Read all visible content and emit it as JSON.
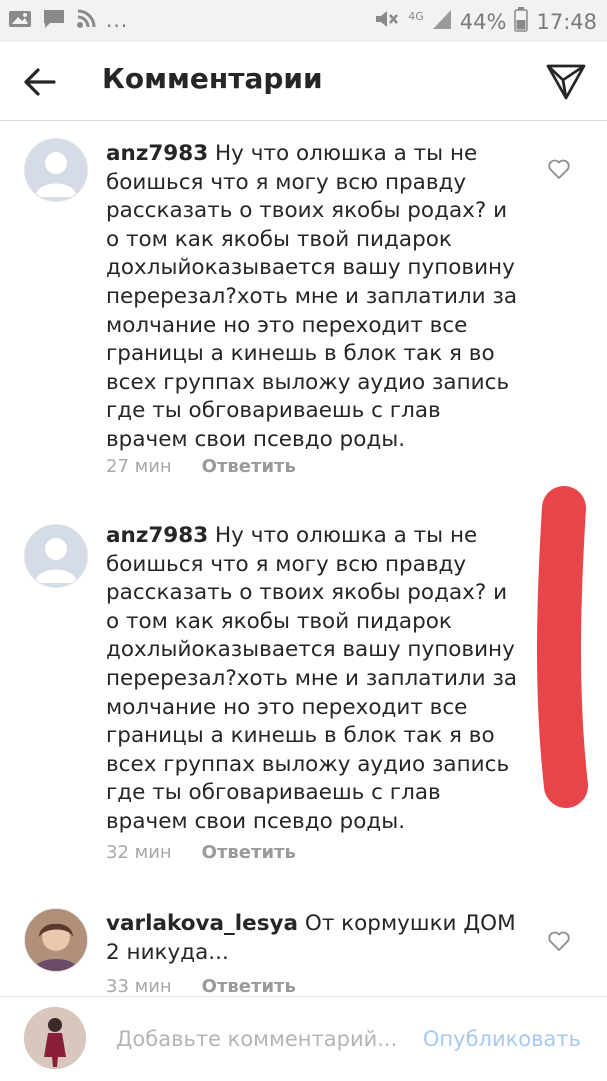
{
  "status_bar": {
    "network": "4G",
    "battery": "44%",
    "time": "17:48",
    "icons": [
      "gallery-icon",
      "message-icon",
      "wifi-icon",
      "more-dots-icon",
      "mute-icon",
      "signal-icon",
      "battery-icon"
    ]
  },
  "header": {
    "title": "Комментарии",
    "back_icon": "back-arrow-icon",
    "send_icon": "direct-send-icon"
  },
  "comments": [
    {
      "username": "anz7983",
      "text": "Ну что олюшка а ты не боишься что я могу всю правду рассказать о твоих якобы родах? и о том как якобы твой пидарок дохлыйоказывается вашу пуповину перерезал?хоть мне и заплатили за молчание но это переходит все границы а кинешь в блок так я во всех группах выложу аудио запись где ты обговариваешь с глав врачем свои псевдо роды.",
      "time": "27 мин",
      "reply_label": "Ответить",
      "has_heart": true
    },
    {
      "username": "anz7983",
      "text": "Ну что олюшка а ты не боишься что я могу всю правду рассказать о твоих якобы родах? и о том как якобы твой пидарок дохлыйоказывается вашу пуповину перерезал?хоть мне и заплатили за молчание но это переходит все границы а кинешь в блок так я во всех группах выложу аудио запись где ты обговариваешь с глав врачем свои псевдо роды.",
      "time": "32 мин",
      "reply_label": "Ответить",
      "has_heart": false
    },
    {
      "username": "varlakova_lesya",
      "text": "От кормушки ДОМ 2 никуда...",
      "time": "33 мин",
      "reply_label": "Ответить",
      "has_heart": true
    }
  ],
  "input": {
    "placeholder": "Добавьте комментарий...",
    "value": "",
    "publish_label": "Опубликовать"
  },
  "colors": {
    "scribble": "#e8454a",
    "link_disabled": "#a7c9f0",
    "muted_text": "#a8a8a8"
  }
}
